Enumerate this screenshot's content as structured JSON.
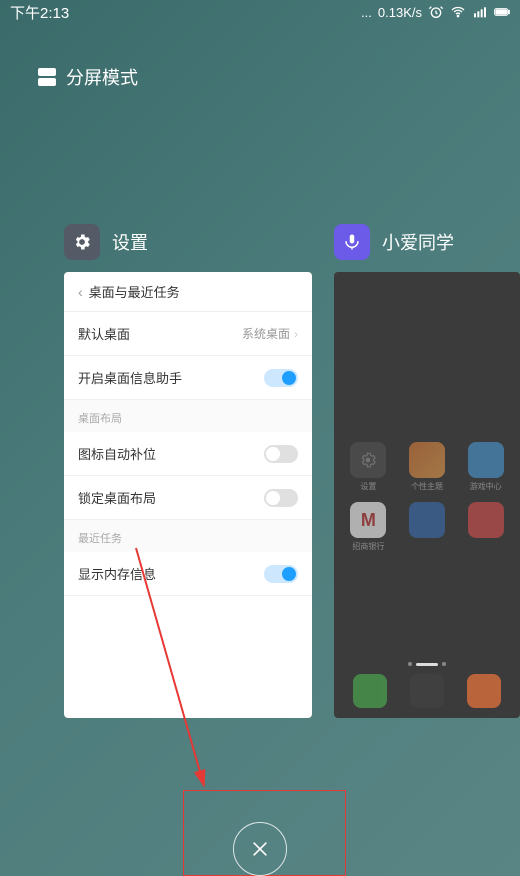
{
  "status": {
    "time": "下午2:13",
    "net_speed": "0.13K/s"
  },
  "split_screen_label": "分屏模式",
  "recent_apps": [
    {
      "name": "设置",
      "icon": "gear",
      "settings_page": {
        "title": "桌面与最近任务",
        "rows": [
          {
            "label": "默认桌面",
            "type": "link",
            "value": "系统桌面"
          },
          {
            "label": "开启桌面信息助手",
            "type": "toggle",
            "on": true
          }
        ],
        "section1_label": "桌面布局",
        "section1_rows": [
          {
            "label": "图标自动补位",
            "type": "toggle",
            "on": false
          },
          {
            "label": "锁定桌面布局",
            "type": "toggle",
            "on": false
          }
        ],
        "section2_label": "最近任务",
        "section2_rows": [
          {
            "label": "显示内存信息",
            "type": "toggle",
            "on": true
          }
        ]
      }
    },
    {
      "name": "小爱同学",
      "icon": "voice",
      "homescreen_icons": [
        {
          "label": "设置",
          "color": "#555"
        },
        {
          "label": "个性主题",
          "color": "#d97b3a"
        },
        {
          "label": "游戏中心",
          "color": "#4a9dd8"
        },
        {
          "label": "招商银行",
          "color": "#c84040"
        },
        {
          "label": "",
          "color": "#3b6fb5"
        },
        {
          "label": "",
          "color": "#d95050"
        }
      ],
      "dock_colors": [
        "#4caf50",
        "#444",
        "#ff7a3d"
      ]
    }
  ],
  "close_label": "×"
}
